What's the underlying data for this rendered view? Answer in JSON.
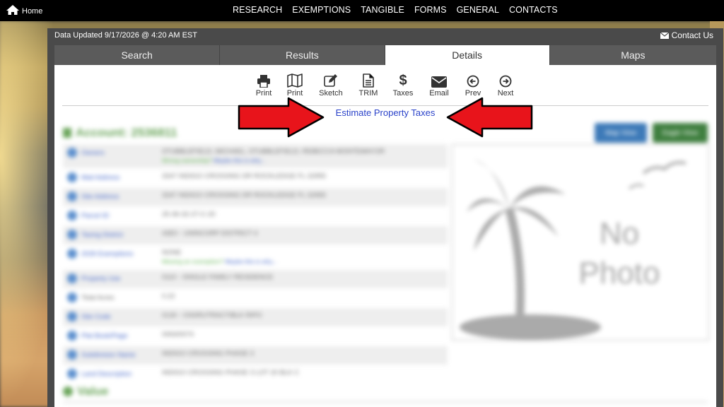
{
  "topnav": {
    "home_label": "Home",
    "links": [
      "RESEARCH",
      "EXEMPTIONS",
      "TANGIBLE",
      "FORMS",
      "GENERAL",
      "CONTACTS"
    ]
  },
  "header": {
    "updated": "Data Updated 9/17/2026 @ 4:20 AM EST",
    "contact": "Contact Us"
  },
  "tabs": [
    {
      "label": "Search",
      "active": false
    },
    {
      "label": "Results",
      "active": false
    },
    {
      "label": "Details",
      "active": true
    },
    {
      "label": "Maps",
      "active": false
    }
  ],
  "toolbar": [
    {
      "label": "Print",
      "icon": "printer-icon"
    },
    {
      "label": "Print",
      "icon": "map-icon"
    },
    {
      "label": "Sketch",
      "icon": "pencil-square-icon"
    },
    {
      "label": "TRIM",
      "icon": "document-icon"
    },
    {
      "label": "Taxes",
      "icon": "dollar-icon"
    },
    {
      "label": "Email",
      "icon": "envelope-icon"
    },
    {
      "label": "Prev",
      "icon": "arrow-left-circle-icon"
    },
    {
      "label": "Next",
      "icon": "arrow-right-circle-icon"
    }
  ],
  "estimate_link": "Estimate Property Taxes",
  "details": {
    "account": "Account: 2536811",
    "map_button": "Map View",
    "eagle_button": "Eagle View",
    "rows": [
      {
        "label": "Owners",
        "value": "STUBBLEFIELD, MICHAEL; STUBBLEFIELD, REBECCA MONTEMAYOR",
        "sub": "Wrong ownership?",
        "sub_link": "Maybe this is why..."
      },
      {
        "label": "Mail Address",
        "value": "3347 INDIGO CROSSING DR ROCKLEDGE FL 32955"
      },
      {
        "label": "Site Address",
        "value": "3347 INDIGO CROSSING DR ROCKLEDGE FL 32955"
      },
      {
        "label": "Parcel ID",
        "value": "25-36-32-27-C-20"
      },
      {
        "label": "Taxing District",
        "value": "43E0 - UNINCORP DISTRICT 4"
      },
      {
        "label": "2026 Exemptions",
        "value": "NONE",
        "sub": "Missing an exemption?",
        "sub_link": "Maybe this is why..."
      },
      {
        "label": "Property Use",
        "value": "0110 - SINGLE FAMILY RESIDENCE"
      },
      {
        "label": "Total Acres",
        "value": "0.22"
      },
      {
        "label": "Site Code",
        "value": "0130 - CNSRUTRACT/BLK RIPO"
      },
      {
        "label": "Plat Book/Page",
        "value": "0063/0074"
      },
      {
        "label": "Subdivision Name",
        "value": "INDIGO CROSSING PHASE 3"
      },
      {
        "label": "Land Description",
        "value": "INDIGO CROSSING PHASE 3 LOT 20 BLK C"
      }
    ],
    "photo_text_1": "No",
    "photo_text_2": "Photo",
    "value_header": "Value"
  },
  "colors": {
    "nav_bg": "#000000",
    "panel_bg": "#4a4a4a",
    "link_blue": "#2a42c9",
    "arrow_red": "#e8141b",
    "accent_green": "#6aa55a"
  }
}
